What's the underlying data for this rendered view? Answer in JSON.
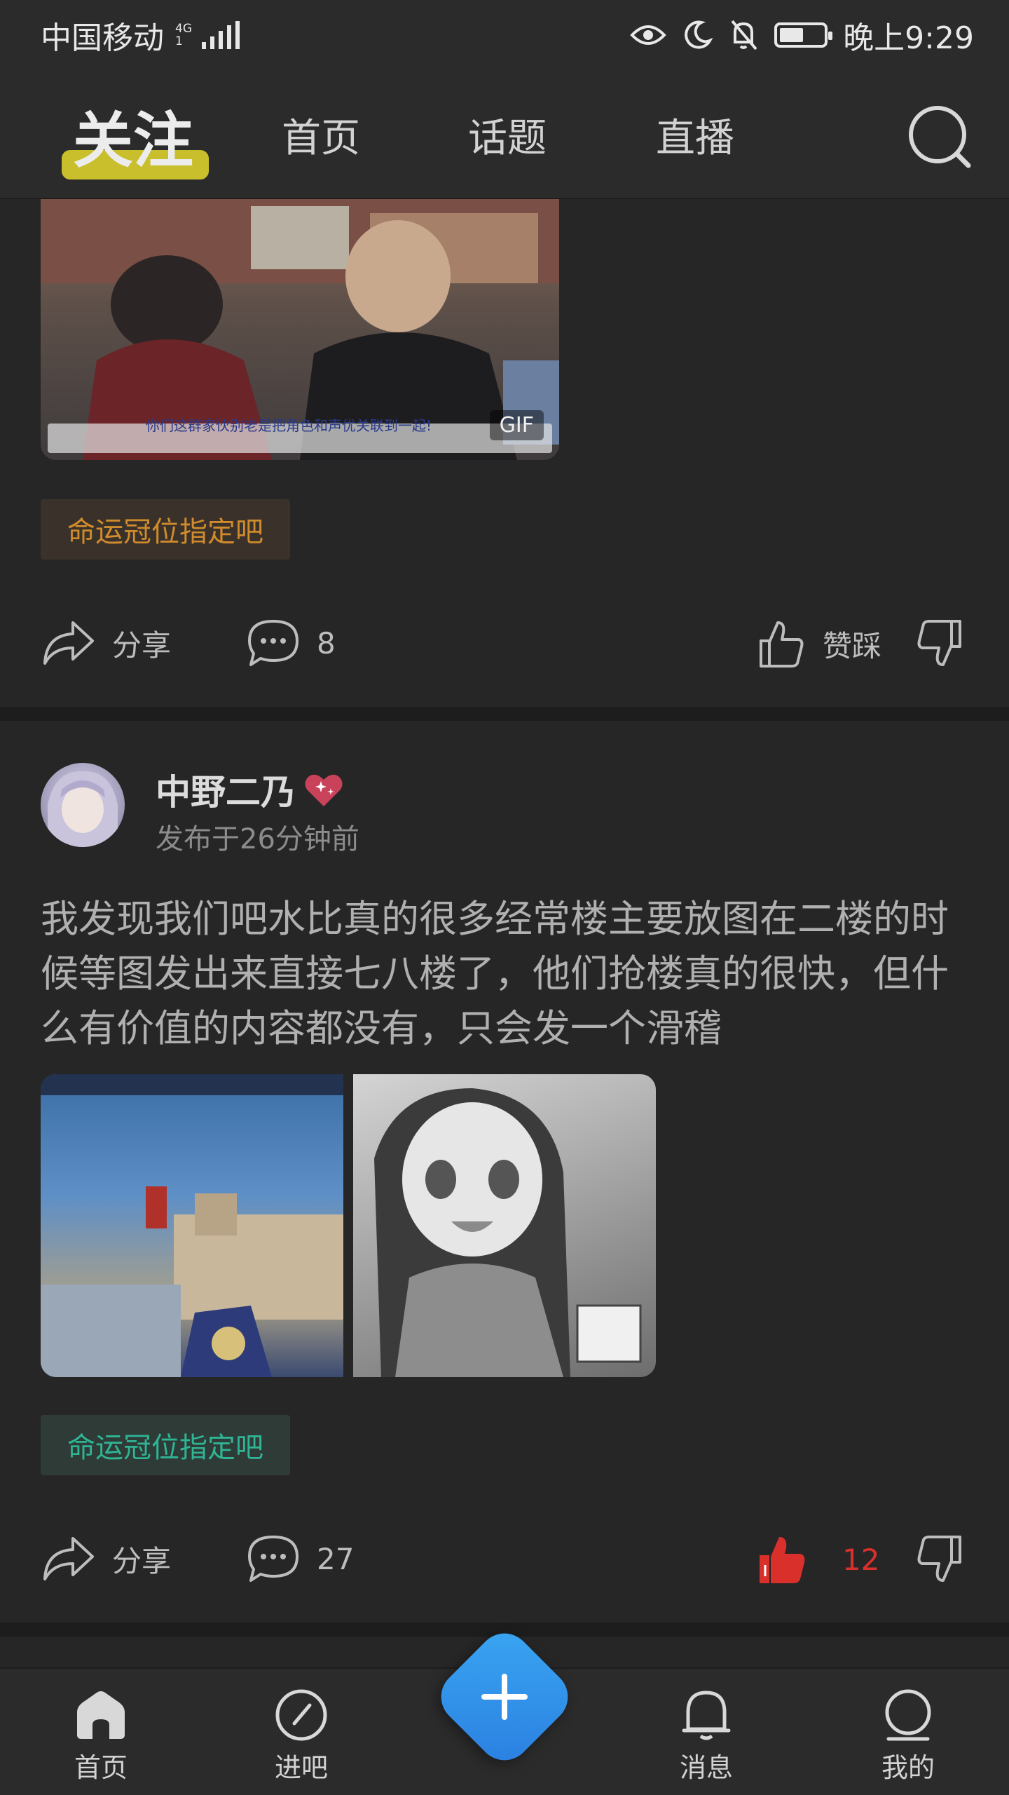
{
  "status_bar": {
    "carrier": "中国移动",
    "network_top": "4G",
    "network_bottom": "1",
    "time": "晚上9:29",
    "battery_level": 0.55
  },
  "top_nav": {
    "tabs": [
      {
        "label": "关注",
        "active": true
      },
      {
        "label": "首页",
        "active": false
      },
      {
        "label": "话题",
        "active": false
      },
      {
        "label": "直播",
        "active": false
      }
    ],
    "underline_color": "#c9bf2c"
  },
  "post1": {
    "image_caption": "你们这群家伙别老是把角色和声优关联到一起!",
    "image_badge": "GIF",
    "topic_tag": "命运冠位指定吧",
    "share_label": "分享",
    "comment_count": "8",
    "vote_label": "赞踩"
  },
  "post2": {
    "username": "中野二乃",
    "time": "发布于26分钟前",
    "text": "我发现我们吧水比真的很多经常楼主要放图在二楼的时候等图发出来直接七八楼了，他们抢楼真的很快，但什么有价值的内容都没有，只会发一个滑稽",
    "topic_tag": "命运冠位指定吧",
    "share_label": "分享",
    "comment_count": "27",
    "like_count": "12"
  },
  "bottom_nav": {
    "items": [
      {
        "label": "首页"
      },
      {
        "label": "进吧"
      },
      {
        "label": "消息"
      },
      {
        "label": "我的"
      }
    ]
  },
  "colors": {
    "accent_blue": "#2f8de8",
    "like_red": "#d9302c",
    "tag_orange": "#d08b2c",
    "tag_green": "#2fb494"
  }
}
